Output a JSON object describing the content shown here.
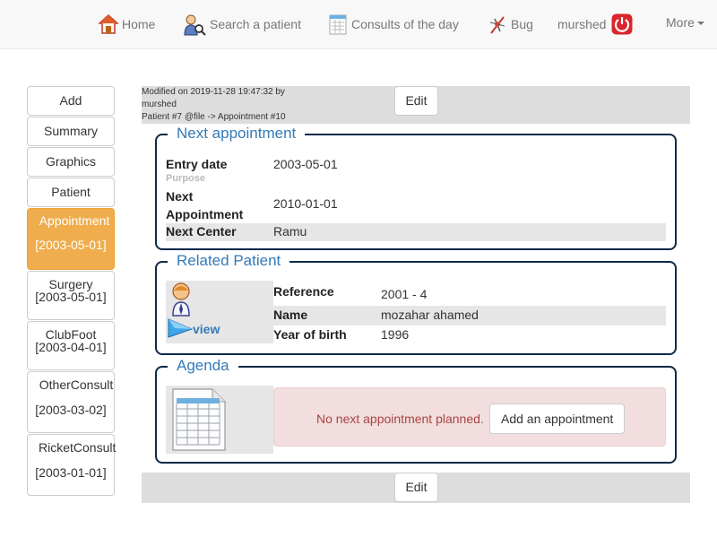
{
  "nav": {
    "home": "Home",
    "search": "Search a patient",
    "consults": "Consults of the day",
    "bug": "Bug",
    "user": "murshed",
    "more": "More"
  },
  "sidebar": {
    "add": "Add",
    "summary": "Summary",
    "graphics": "Graphics",
    "patient": "Patient",
    "appointment": {
      "title": "Appointment",
      "date": "[2003-05-01]"
    },
    "surgery": {
      "title": "Surgery",
      "date": "[2003-05-01]"
    },
    "clubfoot": {
      "title": "ClubFoot",
      "date": "[2003-04-01]"
    },
    "otherconsult": {
      "title": "OtherConsult",
      "date": "[2003-03-02]"
    },
    "ricketconsult": {
      "title": "RicketConsult",
      "date": "[2003-01-01]"
    }
  },
  "meta": {
    "modified": "Modified on 2019-11-28 19:47:32 by",
    "by": "murshed",
    "path": "Patient #7 @file -> Appointment #10"
  },
  "edit_label": "Edit",
  "next_appointment": {
    "legend": "Next appointment",
    "entry_date_label": "Entry date",
    "entry_date": "2003-05-01",
    "purpose_label": "Purpose",
    "next_label_1": "Next",
    "next_label_2": "Appointment",
    "next_date": "2010-01-01",
    "center_label": "Next Center",
    "center": "Ramu"
  },
  "related": {
    "legend": "Related Patient",
    "view": "view",
    "reference_label": "Reference",
    "reference": "2001 - 4",
    "name_label": "Name",
    "name": "mozahar ahamed",
    "yob_label": "Year of birth",
    "yob": "1996"
  },
  "agenda": {
    "legend": "Agenda",
    "message": "No next appointment planned.",
    "add_button": "Add an appointment"
  },
  "colors": {
    "active": "#f0ad4e",
    "link": "#337ab7",
    "alert_bg": "#f2dede",
    "alert_text": "#a94442"
  }
}
